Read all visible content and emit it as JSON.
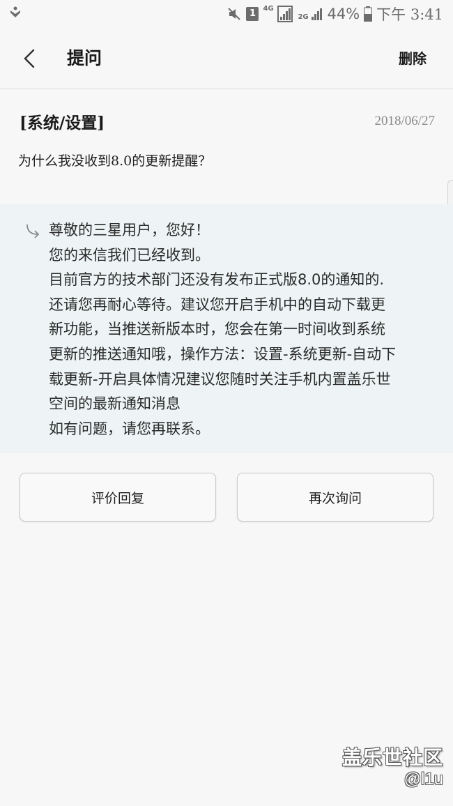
{
  "status_bar": {
    "battery_percent": "44%",
    "time": "下午 3:41",
    "sim_badge": "1",
    "network_4g": "4G",
    "network_2g": "2G",
    "icons": [
      "notification-app-icon",
      "mute-icon",
      "sim-badge-icon",
      "signal-4g-icon",
      "signal-2g-icon",
      "battery-icon"
    ]
  },
  "app_bar": {
    "title": "提问",
    "delete_label": "删除"
  },
  "question": {
    "category": "[系统/设置]",
    "date": "2018/06/27",
    "text": "为什么我没收到8.0的更新提醒？"
  },
  "reply": {
    "lines": [
      "尊敬的三星用户，您好！",
      "您的来信我们已经收到。",
      "目前官方的技术部门还没有发布正式版8.0的通知的.",
      "还请您再耐心等待。建议您开启手机中的自动下载更",
      "新功能，当推送新版本时，您会在第一时间收到系统",
      "更新的推送通知哦，操作方法：设置-系统更新-自动下",
      "载更新-开启具体情况建议您随时关注手机内置盖乐世",
      "空间的最新通知消息",
      "如有问题，请您再联系。"
    ]
  },
  "actions": {
    "rate_label": "评价回复",
    "ask_again_label": "再次询问"
  },
  "watermark": {
    "site": "盖乐世社区",
    "user": "@l1u"
  },
  "colors": {
    "background": "#f7f7f7",
    "reply_background": "#eef4f5",
    "text": "#1e1e1e",
    "muted": "#8a8a8a"
  }
}
